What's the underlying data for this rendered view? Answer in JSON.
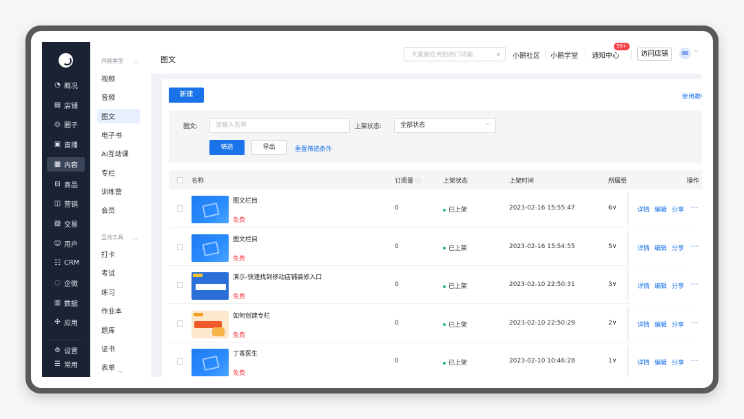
{
  "nav": {
    "items": [
      {
        "label": "概况",
        "icon": "◔"
      },
      {
        "label": "店铺",
        "icon": "▤"
      },
      {
        "label": "圈子",
        "icon": "◎"
      },
      {
        "label": "直播",
        "icon": "▣"
      },
      {
        "label": "内容",
        "icon": "▦"
      },
      {
        "label": "商品",
        "icon": "⊟"
      },
      {
        "label": "营销",
        "icon": "◫"
      },
      {
        "label": "交易",
        "icon": "▧"
      },
      {
        "label": "用户",
        "icon": "☺"
      },
      {
        "label": "CRM",
        "icon": "☷"
      },
      {
        "label": "企微",
        "icon": "◌"
      },
      {
        "label": "数据",
        "icon": "▥"
      },
      {
        "label": "应用",
        "icon": "✣"
      }
    ],
    "bottom": [
      {
        "label": "设置",
        "icon": "⚙"
      },
      {
        "label": "常用",
        "icon": "☰"
      }
    ]
  },
  "subnav": {
    "group1": "内容类型",
    "group1_items": [
      "视频",
      "音频",
      "图文",
      "电子书",
      "AI互动课",
      "专栏",
      "训练营",
      "会员"
    ],
    "group2": "互动工具",
    "group2_items": [
      "打卡",
      "考试",
      "练习",
      "作业本",
      "题库",
      "证书",
      "表单"
    ]
  },
  "header": {
    "title": "图文",
    "search_placeholder": "大家都在用的热门功能",
    "links": [
      "小鹅社区",
      "小鹅学堂",
      "通知中心"
    ],
    "badge": "99+",
    "visit": "访问店铺"
  },
  "toolbar": {
    "new_label": "新建",
    "help_label": "使用教程"
  },
  "filter": {
    "name_label": "图文:",
    "name_placeholder": "请输入名称",
    "status_label": "上架状态:",
    "status_value": "全部状态",
    "filter_button": "筛选",
    "export_button": "导出",
    "reset_link": "重置筛选条件"
  },
  "table": {
    "headers": {
      "name": "名称",
      "subs": "订阅量",
      "status": "上架状态",
      "time": "上架时间",
      "group": "所属组",
      "ops": "操作"
    },
    "op_labels": [
      "详情",
      "编辑",
      "分享"
    ],
    "rows": [
      {
        "title": "图文栏目",
        "price": "免费",
        "subs": "0",
        "status": "已上架",
        "time": "2023-02-16 15:55:47",
        "group": "6∨",
        "thumb": "blue"
      },
      {
        "title": "图文栏目",
        "price": "免费",
        "subs": "0",
        "status": "已上架",
        "time": "2023-02-16 15:54:55",
        "group": "5∨",
        "thumb": "blue"
      },
      {
        "title": "演示-快速找到移动店铺装修入口",
        "price": "免费",
        "subs": "0",
        "status": "已上架",
        "time": "2023-02-10 22:50:31",
        "group": "3∨",
        "thumb": "promo1"
      },
      {
        "title": "如何创建专栏",
        "price": "免费",
        "subs": "0",
        "status": "已上架",
        "time": "2023-02-10 22:50:29",
        "group": "2∨",
        "thumb": "promo2"
      },
      {
        "title": "丁香医生",
        "price": "免费",
        "subs": "0",
        "status": "已上架",
        "time": "2023-02-10 10:46:28",
        "group": "1∨",
        "thumb": "blue"
      }
    ]
  }
}
